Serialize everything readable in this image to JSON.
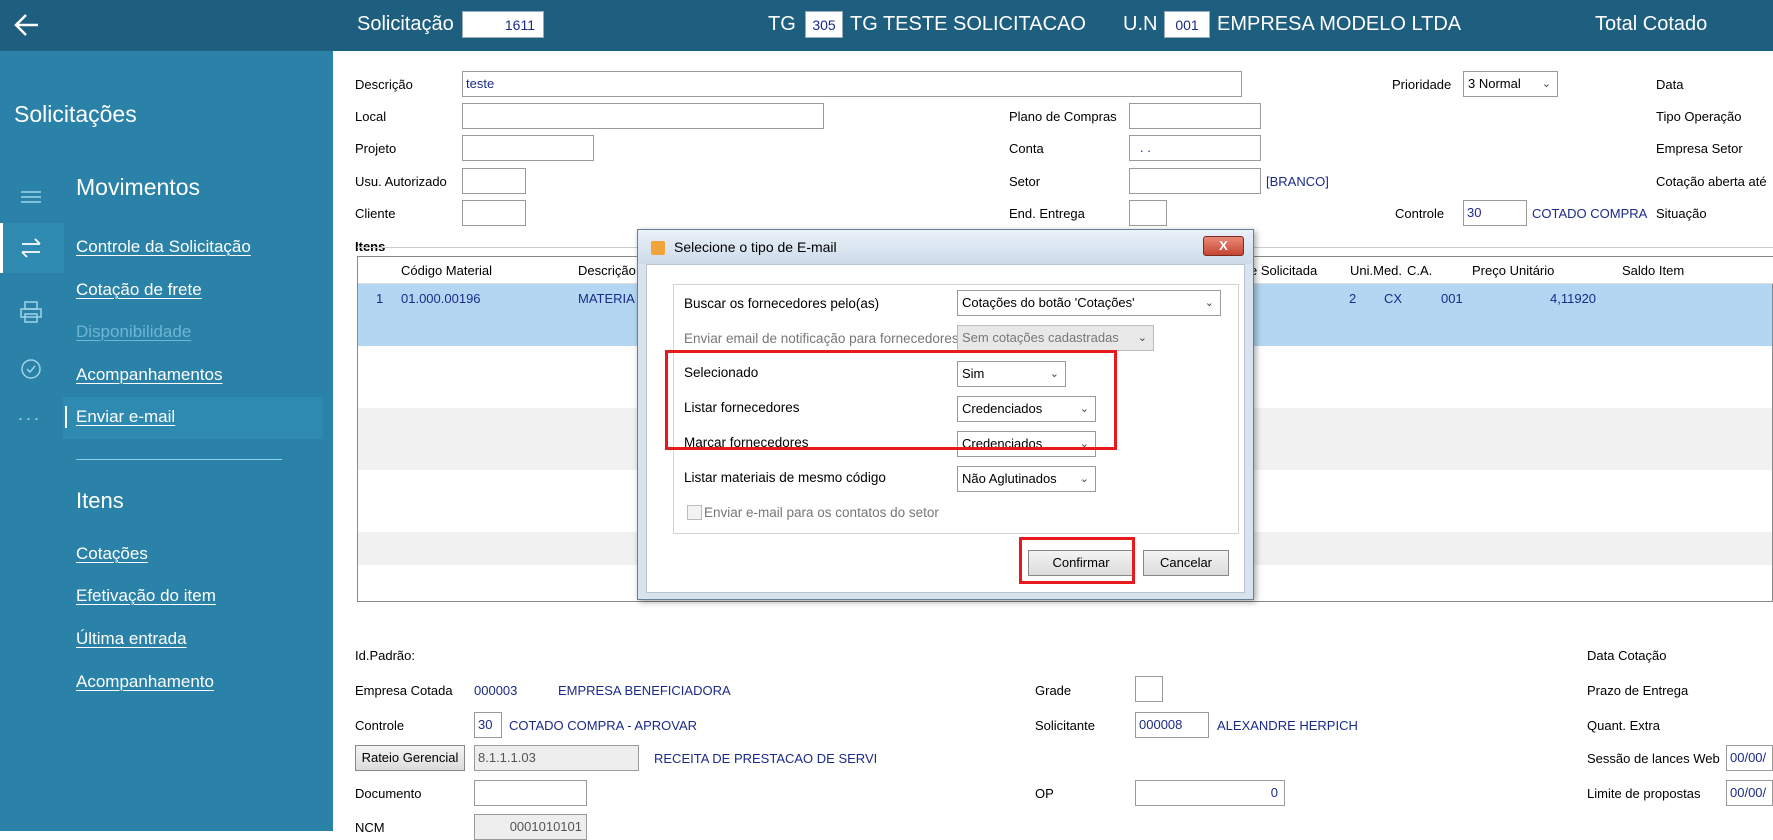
{
  "topbar": {
    "solicitacao_label": "Solicitação",
    "solicitacao_value": "1611",
    "tg_label": "TG",
    "tg_code": "305",
    "tg_name": "TG TESTE SOLICITACAO",
    "un_label": "U.N",
    "un_code": "001",
    "un_name": "EMPRESA MODELO LTDA",
    "total_label": "Total Cotado"
  },
  "sidebar": {
    "title": "Solicitações",
    "section1": "Movimentos",
    "items1": [
      "Controle da Solicitação",
      "Cotação de frete",
      "Disponibilidade",
      "Acompanhamentos",
      "Enviar e-mail"
    ],
    "section2": "Itens",
    "items2": [
      "Cotações",
      "Efetivação do item",
      "Última entrada",
      "Acompanhamento"
    ],
    "more": "..."
  },
  "form": {
    "descricao_label": "Descrição",
    "descricao_value": "teste",
    "local_label": "Local",
    "projeto_label": "Projeto",
    "usu_label": "Usu. Autorizado",
    "cliente_label": "Cliente",
    "plano_label": "Plano de Compras",
    "conta_label": "Conta",
    "conta_value": ". .",
    "setor_label": "Setor",
    "setor_extra": "[BRANCO]",
    "end_label": "End. Entrega",
    "prioridade_label": "Prioridade",
    "prioridade_value": "3 Normal",
    "controle_label": "Controle",
    "controle_value": "30",
    "controle_text": "COTADO COMPRA",
    "right_labels": [
      "Data",
      "Tipo Operação",
      "Empresa Setor",
      "Cotação aberta até",
      "Situação"
    ]
  },
  "itens": {
    "title": "Itens",
    "columns": [
      "Código Material",
      "Descrição",
      "e Solicitada",
      "Uni.Med.",
      "C.A.",
      "Preço Unitário",
      "Saldo Item"
    ],
    "row": {
      "n": "1",
      "codigo": "01.000.00196",
      "descricao": "MATERIA",
      "qtd": "2",
      "uni": "CX",
      "ca": "001",
      "preco": "4,11920"
    }
  },
  "bottom": {
    "idpadrao_label": "Id.Padrão:",
    "empresa_label": "Empresa Cotada",
    "empresa_code": "000003",
    "empresa_name": "EMPRESA BENEFICIADORA",
    "controle_label": "Controle",
    "controle_value": "30",
    "controle_text": "COTADO COMPRA - APROVAR",
    "rateio_button": "Rateio Gerencial",
    "rateio_value": "8.1.1.1.03",
    "rateio_text": "RECEITA DE PRESTACAO DE SERVICO",
    "documento_label": "Documento",
    "ncm_label": "NCM",
    "ncm_value": "0001010101",
    "grade_label": "Grade",
    "solicitante_label": "Solicitante",
    "solicitante_code": "000008",
    "solicitante_name": "ALEXANDRE HERPICH",
    "op_label": "OP",
    "op_value": "0",
    "right_labels": [
      "Data Cotação",
      "Prazo de Entrega",
      "Quant. Extra",
      "Sessão de lances Web",
      "Limite de propostas"
    ],
    "right_values": [
      "00/00/",
      "00/00/"
    ]
  },
  "dialog": {
    "title": "Selecione o tipo de E-mail",
    "close": "X",
    "buscar_label": "Buscar os fornecedores pelo(as)",
    "buscar_value": "Cotações do botão 'Cotações'",
    "enviar_label": "Enviar email de notificação para fornecedores",
    "enviar_value": "Sem cotações cadastradas",
    "selecionado_label": "Selecionado",
    "selecionado_value": "Sim",
    "listar_label": "Listar fornecedores",
    "listar_value": "Credenciados",
    "marcar_label": "Marcar fornecedores",
    "marcar_value": "Credenciados",
    "materiais_label": "Listar materiais de mesmo código",
    "materiais_value": "Não Aglutinados",
    "contatos_label": "Enviar e-mail para os contatos do setor",
    "confirmar": "Confirmar",
    "cancelar": "Cancelar"
  },
  "colors": {
    "topbar": "#1e5e7f",
    "sidebar": "#2a82a8",
    "highlight": "#e8191d",
    "selected_row": "#b3d7f2"
  }
}
